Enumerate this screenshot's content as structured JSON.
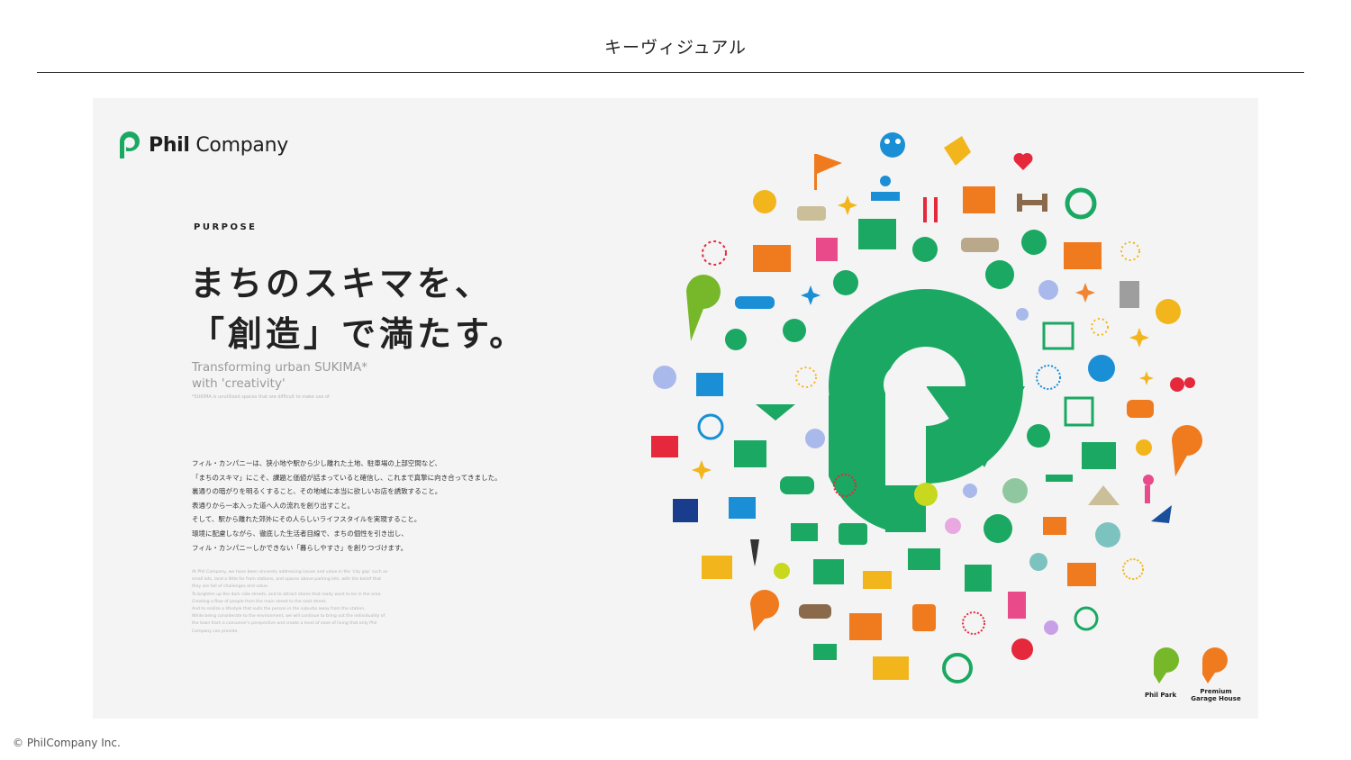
{
  "slide": {
    "title": "キーヴィジュアル"
  },
  "brand": {
    "logo_name": "Phil Company",
    "logo_bold": "Phil",
    "logo_rest": "Company",
    "green": "#1aa862",
    "orange": "#f07a1e"
  },
  "purpose": {
    "label": "PURPOSE",
    "headline": "まちのスキマを、\n「創造」で満たす。",
    "english_tagline": "Transforming urban SUKIMA*\nwith 'creativity'",
    "note": "*SUKIMA is unutilized spaces that are difficult to make use of",
    "body_jp": "フィル・カンパニーは、狭小地や駅から少し離れた土地、駐車場の上部空間など、\n「まちのスキマ」にこそ、課題と価値が詰まっていると確信し、これまで真摯に向き合ってきました。\n裏通りの暗がりを明るくすること、その地域に本当に欲しいお店を誘致すること。\n表通りから一本入った道へ人の流れを創り出すこと。\nそして、駅から離れた郊外にその人らしいライフスタイルを実現すること。\n環境に配慮しながら、徹底した生活者目線で、まちの個性を引き出し、\nフィル・カンパニーしかできない「暮らしやすさ」を創りつづけます。",
    "body_en": "At Phil Company, we have been sincerely addressing issues and value in the 'city gap' such as\nsmall lots, land a little far from stations, and spaces above parking lots, with the belief that\nthey are full of challenges and value.\nTo brighten up the dark side streets, and to attract stores that really want to be in the area.\nCreating a flow of people from the main street to the next street.\nAnd to realize a lifestyle that suits the person in the suburbs away from the station.\nWhile being considerate to the environment, we will continue to bring out the individuality of\nthe town from a consumer's perspective and create a level of ease of living that only Phil\nCompany can provide."
  },
  "sub_brands": [
    {
      "name": "Phil Park",
      "color": "#76b82a"
    },
    {
      "name": "Premium\nGarage House",
      "color": "#f07a1e"
    }
  ],
  "footer": {
    "copyright": "© PhilCompany Inc."
  },
  "icons": [
    "people-icon",
    "handshake-icon",
    "heart-icon",
    "flag-icon",
    "person-desk-icon",
    "smile-sun-icon",
    "sofa-icon",
    "cutlery-icon",
    "building-icon",
    "dumbbell-icon",
    "recycle-icon",
    "car-icon",
    "pin-icon",
    "shop-icon",
    "firework-icon",
    "clothes-icon",
    "clock-icon",
    "bicycle-icon",
    "flower-icon",
    "book-icon",
    "stethoscope-icon",
    "thumbs-up-icon",
    "chart-icon",
    "music-icon",
    "burger-icon",
    "cube-icon",
    "tree-icon",
    "hammer-icon",
    "tent-icon",
    "dancer-icon",
    "arrow-up-icon",
    "tie-icon",
    "solar-icon",
    "bike-icon",
    "beer-icon",
    "coffee-icon",
    "palette-icon",
    "pills-icon",
    "scissors-icon",
    "plant-icon",
    "spring-icon",
    "crowd-icon",
    "sparkle-icon",
    "golf-icon"
  ]
}
